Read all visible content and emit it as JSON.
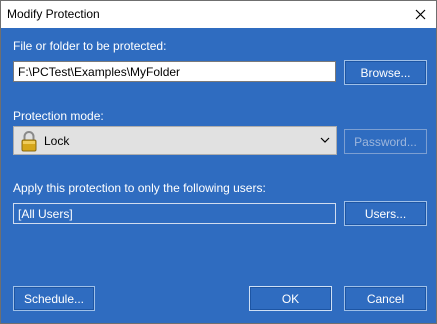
{
  "window": {
    "title": "Modify Protection",
    "close_icon": "close-icon"
  },
  "path_section": {
    "label": "File or folder to be protected:",
    "value": "F:\\PCTest\\Examples\\MyFolder",
    "browse_label": "Browse..."
  },
  "mode_section": {
    "label": "Protection mode:",
    "selected": "Lock",
    "icon": "padlock-icon",
    "password_label": "Password...",
    "password_enabled": false
  },
  "users_section": {
    "label": "Apply this protection to only the following users:",
    "value": "[All Users]",
    "users_label": "Users..."
  },
  "footer": {
    "schedule_label": "Schedule...",
    "ok_label": "OK",
    "cancel_label": "Cancel"
  },
  "colors": {
    "dialog_background": "#2f6cc0",
    "text_on_background": "#ffffff"
  }
}
